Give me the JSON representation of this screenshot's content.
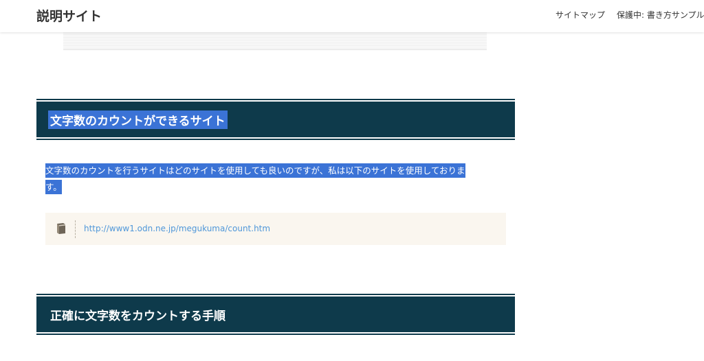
{
  "header": {
    "site_title": "説明サイト",
    "nav": [
      "サイトマップ",
      "保護中: 書き方サンプル"
    ]
  },
  "article": {
    "section1": {
      "heading": "文字数のカウントができるサイト",
      "paragraph_line1": "文字数のカウントを行うサイトはどのサイトを使用しても良いのですが、私は以下のサイトを使用しておりま",
      "paragraph_line2": "す。",
      "link": {
        "icon": "book-icon",
        "url_text": "http://www1.odn.ne.jp/megukuma/count.htm"
      }
    },
    "section2": {
      "heading": "正確に文字数をカウントする手順"
    }
  },
  "colors": {
    "heading_bg": "#0e3a4b",
    "selection": "#3b73d6",
    "link": "#4f97d9",
    "link_box_bg": "#faf6ef"
  }
}
